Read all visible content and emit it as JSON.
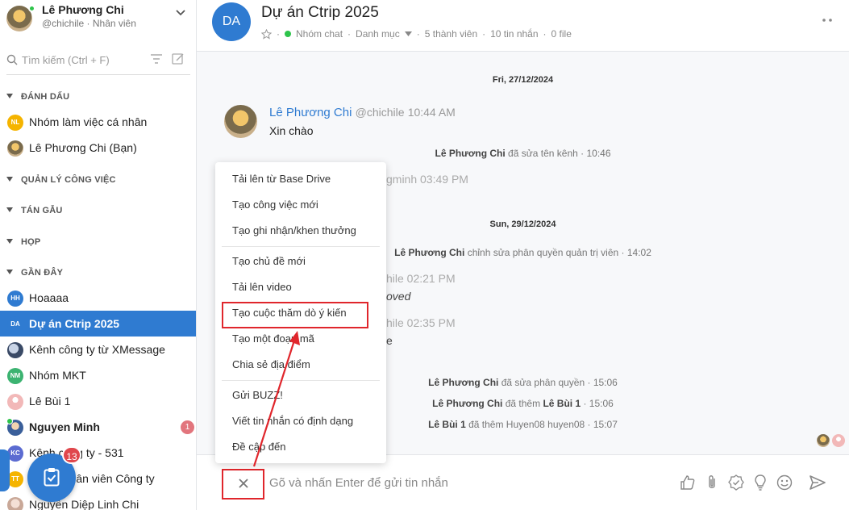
{
  "user": {
    "name": "Lê Phương Chi",
    "handle": "@chichile · Nhân viên"
  },
  "search": {
    "placeholder": "Tìm kiếm (Ctrl + F)"
  },
  "sections": {
    "starred": "ĐÁNH DẤU",
    "tasks": "QUẢN LÝ CÔNG VIỆC",
    "chat": "TÁN GẪU",
    "meeting": "HỌP",
    "recent": "GẦN ĐÂY"
  },
  "starred_items": [
    {
      "initials": "NL",
      "label": "Nhóm làm việc cá nhân",
      "color": "#f5b400"
    },
    {
      "initials": "",
      "label": "Lê Phương Chi (Bạn)",
      "color": ""
    }
  ],
  "recent_items": [
    {
      "initials": "HH",
      "label": "Hoaaaa",
      "color": "#2f7bd1"
    },
    {
      "initials": "DA",
      "label": "Dự án Ctrip 2025",
      "color": "#2f7bd1"
    },
    {
      "initials": "",
      "label": "Kênh công ty từ XMessage",
      "color": ""
    },
    {
      "initials": "NM",
      "label": "Nhóm MKT",
      "color": "#3cb371"
    },
    {
      "initials": "",
      "label": "Lê Bùi 1",
      "color": "#f2b8b8"
    },
    {
      "initials": "",
      "label": "Nguyen Minh",
      "color": "",
      "badge": "1"
    },
    {
      "initials": "KC",
      "label": "Kênh công ty - 531",
      "color": "#5b6bd1"
    },
    {
      "initials": "TT",
      "label": "Tất cả nhân viên Công ty",
      "color": "#f5b400"
    },
    {
      "initials": "",
      "label": "Nguyễn Diệp Linh Chi",
      "color": ""
    }
  ],
  "fab_badge": "13",
  "channel": {
    "initials": "DA",
    "title": "Dự án Ctrip 2025",
    "type": "Nhóm chat",
    "category": "Danh mục",
    "members": "5 thành viên",
    "messages": "10 tin nhắn",
    "files": "0 file"
  },
  "messages": {
    "date1": "Fri, 27/12/2024",
    "author": "Lê Phương Chi",
    "author_handle": "@chichile",
    "author_time": "10:44 AM",
    "text": "Xin chào",
    "sys1_name": "Lê Phương Chi",
    "sys1_rest": "đã sửa tên kênh · 10:46",
    "faded1": "gminh 03:49 PM",
    "date2": "Sun, 29/12/2024",
    "sys2_name": "Lê Phương Chi",
    "sys2_rest": "chỉnh sửa phân quyền quản trị viên · 14:02",
    "faded2": "hile 02:21 PM",
    "faded3": "oved",
    "faded4": "hile 02:35 PM",
    "faded5": "e",
    "sys3_name": "Lê Phương Chi",
    "sys3_rest": "đã sửa phân quyền · 15:06",
    "sys4_name": "Lê Phương Chi",
    "sys4_mid": "đã thêm",
    "sys4_target": "Lê Bùi 1",
    "sys4_rest": "· 15:06",
    "sys5_name": "Lê Bùi 1",
    "sys5_rest": "đã thêm Huyen08 huyen08 · 15:07"
  },
  "composer": {
    "placeholder": "Gõ và nhấn Enter để gửi tin nhắn"
  },
  "menu": {
    "items": [
      "Tải lên từ Base Drive",
      "Tạo công việc mới",
      "Tạo ghi nhận/khen thưởng",
      "Tạo chủ đề mới",
      "Tải lên video",
      "Tạo cuộc thăm dò ý kiến",
      "Tạo một đoạn mã",
      "Chia sẻ địa điểm",
      "Gửi BUZZ!",
      "Viết tin nhắn có định dạng",
      "Đề cập đến"
    ]
  },
  "colors": {
    "accent": "#2f7bd1",
    "highlight": "#e0262c",
    "online": "#2ec44b"
  }
}
